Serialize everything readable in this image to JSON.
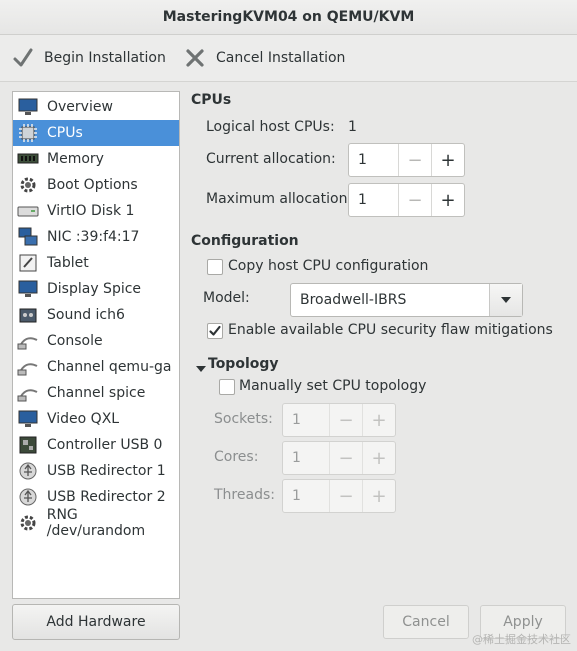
{
  "window": {
    "title": "MasteringKVM04 on QEMU/KVM"
  },
  "toolbar": {
    "begin_label": "Begin Installation",
    "cancel_label": "Cancel Installation"
  },
  "sidebar": {
    "items": [
      {
        "label": "Overview",
        "icon": "monitor-icon"
      },
      {
        "label": "CPUs",
        "icon": "cpu-icon",
        "selected": true
      },
      {
        "label": "Memory",
        "icon": "memory-icon"
      },
      {
        "label": "Boot Options",
        "icon": "gear-icon"
      },
      {
        "label": "VirtIO Disk 1",
        "icon": "disk-icon"
      },
      {
        "label": "NIC :39:f4:17",
        "icon": "network-icon"
      },
      {
        "label": "Tablet",
        "icon": "tablet-icon"
      },
      {
        "label": "Display Spice",
        "icon": "display-icon"
      },
      {
        "label": "Sound ich6",
        "icon": "sound-icon"
      },
      {
        "label": "Console",
        "icon": "console-icon"
      },
      {
        "label": "Channel qemu-ga",
        "icon": "channel-icon"
      },
      {
        "label": "Channel spice",
        "icon": "channel-icon"
      },
      {
        "label": "Video QXL",
        "icon": "video-icon"
      },
      {
        "label": "Controller USB 0",
        "icon": "controller-icon"
      },
      {
        "label": "USB Redirector 1",
        "icon": "usb-icon"
      },
      {
        "label": "USB Redirector 2",
        "icon": "usb-icon"
      },
      {
        "label": "RNG /dev/urandom",
        "icon": "rng-icon"
      }
    ],
    "add_hardware_label": "Add Hardware"
  },
  "cpus": {
    "heading": "CPUs",
    "logical_label": "Logical host CPUs:",
    "logical_value": "1",
    "current_label": "Current allocation:",
    "current_value": "1",
    "max_label": "Maximum allocation:",
    "max_value": "1"
  },
  "configuration": {
    "heading": "Configuration",
    "copy_host_label": "Copy host CPU configuration",
    "copy_host_checked": false,
    "model_label": "Model:",
    "model_value": "Broadwell-IBRS",
    "security_label": "Enable available CPU security flaw mitigations",
    "security_checked": true
  },
  "topology": {
    "heading": "Topology",
    "manual_label": "Manually set CPU topology",
    "manual_checked": false,
    "sockets_label": "Sockets:",
    "sockets_value": "1",
    "cores_label": "Cores:",
    "cores_value": "1",
    "threads_label": "Threads:",
    "threads_value": "1"
  },
  "footer": {
    "cancel_label": "Cancel",
    "apply_label": "Apply"
  },
  "watermark": "@稀土掘金技术社区",
  "colors": {
    "selection": "#4a90d9",
    "window_bg": "#e8e8e7"
  }
}
